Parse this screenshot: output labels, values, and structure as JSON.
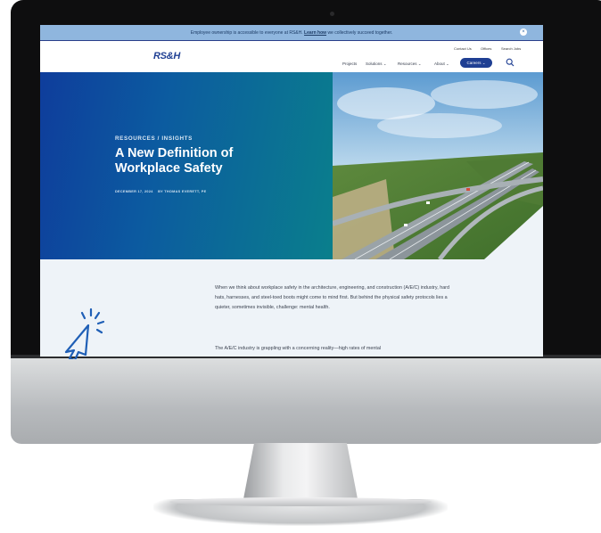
{
  "banner": {
    "text_before": "Employee ownership is accessible to everyone at RS&H.",
    "link": "Learn how",
    "text_after": "we collectively succeed together."
  },
  "nav": {
    "logo": "RS&H",
    "utility": [
      "Contact Us",
      "Offices",
      "Search Jobs"
    ],
    "items": [
      "Projects",
      "Solutions",
      "Resources",
      "About"
    ],
    "careers": "Careers"
  },
  "hero": {
    "eyebrow": "RESOURCES / INSIGHTS",
    "title": "A New Definition of Workplace Safety",
    "date": "DECEMBER 17, 2024",
    "author": "BY THOMAS EVERETT, PE"
  },
  "article": {
    "paragraphs": [
      "When we think about workplace safety in the architecture, engineering, and construction (A/E/C) industry, hard hats, harnesses, and steel-toed boots might come to mind first. But behind the physical safety protocols lies a quieter, sometimes invisible, challenge: mental health.",
      "The A/E/C industry is grappling with a concerning reality—high rates of mental"
    ]
  },
  "colors": {
    "brand_blue": "#1f3f93",
    "banner": "#8fb6de",
    "cursor": "#1f5fb6"
  },
  "icons": {
    "search": "search-icon",
    "close": "close-icon",
    "cursor": "click-cursor-icon"
  }
}
